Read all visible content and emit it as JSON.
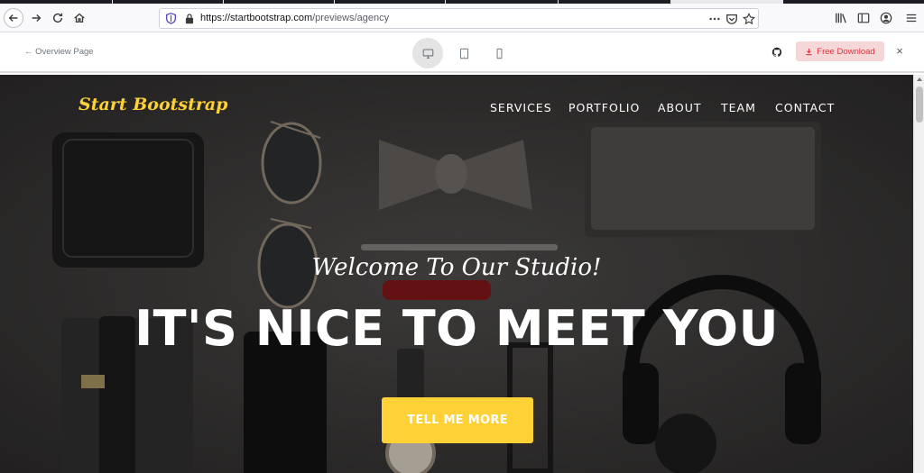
{
  "browser": {
    "url_host": "https://startbootstrap.com",
    "url_path": "/previews/agency",
    "icons": [
      "back-icon",
      "forward-icon",
      "reload-icon",
      "home-icon",
      "tracking-shield-icon",
      "lock-icon",
      "more-icon",
      "pocket-icon",
      "bookmark-star-icon",
      "library-icon",
      "sidebar-icon",
      "account-icon",
      "menu-icon"
    ]
  },
  "preview_bar": {
    "overview_label": "Overview Page",
    "free_download_label": "Free Download",
    "close_label": "×",
    "accent_color": "#d9363e"
  },
  "hero": {
    "brand": "Start Bootstrap",
    "menu": [
      "SERVICES",
      "PORTFOLIO",
      "ABOUT",
      "TEAM",
      "CONTACT"
    ],
    "subheading": "Welcome To Our Studio!",
    "heading": "IT'S NICE TO MEET YOU",
    "cta_label": "TELL ME MORE",
    "accent_color": "#fed136"
  }
}
